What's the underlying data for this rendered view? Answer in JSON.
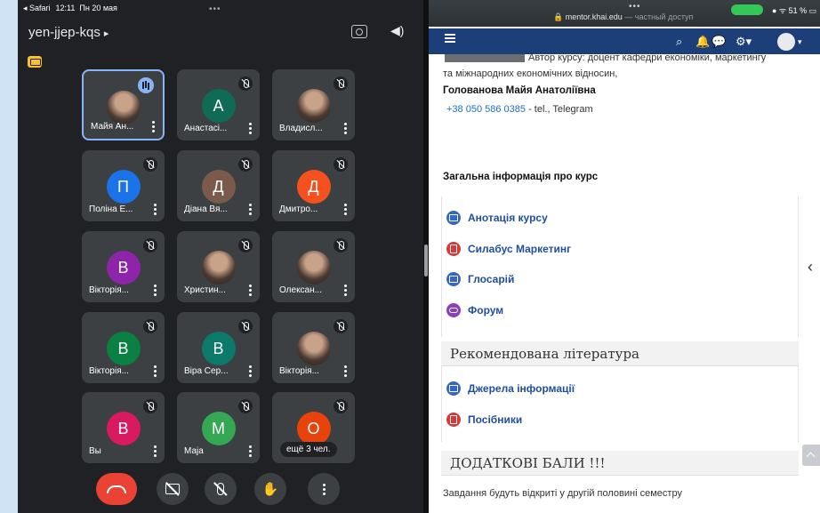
{
  "status_bar": {
    "back_app": "◂ Safari",
    "time": "12:11",
    "date": "Пн 20 мая"
  },
  "meet": {
    "meeting_code": "yen-jjep-kqs",
    "participants": [
      {
        "name": "Майя Ан...",
        "initial": "",
        "avatar_color": "",
        "photo": true,
        "speaking": true,
        "active": true
      },
      {
        "name": "Анастасі...",
        "initial": "А",
        "avatar_color": "#0f6b56",
        "photo": false
      },
      {
        "name": "Владисл...",
        "initial": "",
        "avatar_color": "",
        "photo": true
      },
      {
        "name": "Поліна Е...",
        "initial": "П",
        "avatar_color": "#1a73e8",
        "photo": false
      },
      {
        "name": "Діана Вя...",
        "initial": "Д",
        "avatar_color": "#7b5a4c",
        "photo": false
      },
      {
        "name": "Дмитро...",
        "initial": "Д",
        "avatar_color": "#f4511e",
        "photo": false
      },
      {
        "name": "Вікторія...",
        "initial": "В",
        "avatar_color": "#8e24aa",
        "photo": false
      },
      {
        "name": "Христин...",
        "initial": "",
        "avatar_color": "",
        "photo": true
      },
      {
        "name": "Олексан...",
        "initial": "",
        "avatar_color": "",
        "photo": true
      },
      {
        "name": "Вікторія...",
        "initial": "В",
        "avatar_color": "#0b8043",
        "photo": false
      },
      {
        "name": "Віра Сер...",
        "initial": "В",
        "avatar_color": "#0b7a6a",
        "photo": false
      },
      {
        "name": "Вікторія...",
        "initial": "",
        "avatar_color": "",
        "photo": true
      },
      {
        "name": "Вы",
        "initial": "В",
        "avatar_color": "#d81b60",
        "photo": false
      },
      {
        "name": "Маја",
        "initial": "М",
        "avatar_color": "#34a853",
        "photo": false
      }
    ],
    "more_tile": {
      "initial": "О",
      "avatar_color": "#e8430b",
      "label": "ещё 3 чел."
    }
  },
  "browser": {
    "url": "mentor.khai.edu",
    "url_note": "— частный доступ",
    "battery": "51 %"
  },
  "course": {
    "author_line1": "Автор курсу: доцент кафедри економіки, маркетингу",
    "author_line2": "та міжнародних економічних відносин,",
    "teacher_name": "Голованова Майя Анатоліївна",
    "phone": "+38 050 586 0385",
    "phone_suffix": " - tel., Telegram",
    "general_info": "Загальна інформація про курс",
    "activities": [
      {
        "label": "Анотація курсу",
        "icon": "page-icon"
      },
      {
        "label": "Силабус Маркетинг",
        "icon": "pdf-icon"
      },
      {
        "label": "Глосарій",
        "icon": "page-icon"
      },
      {
        "label": "Форум",
        "icon": "forum-icon"
      }
    ],
    "section_literature": "Рекомендована література",
    "literature": [
      {
        "label": "Джерела інформації",
        "icon": "page-icon"
      },
      {
        "label": "Посібники",
        "icon": "pdf-icon"
      }
    ],
    "section_bonus": "ДОДАТКОВІ БАЛИ !!!",
    "bonus_note": "Завдання будуть відкриті у другій половині семестру"
  }
}
